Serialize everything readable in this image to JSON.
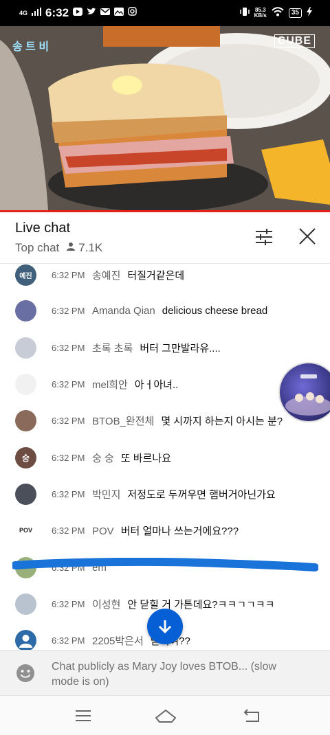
{
  "status_bar": {
    "network": "4G",
    "time": "6:32",
    "speed": "85.3",
    "speed_unit": "KB/s",
    "battery": "35"
  },
  "video": {
    "channel_logo": "CUBE",
    "show_logo": "송 트 비"
  },
  "chat_header": {
    "title": "Live chat",
    "mode": "Top chat",
    "viewer_count": "7.1K"
  },
  "messages": [
    {
      "avatar_text": "예진",
      "avatar_color": "#3f5f7a",
      "time": "6:32 PM",
      "author": "송예진",
      "text": "터질거같은데"
    },
    {
      "avatar_text": "",
      "avatar_color": "#6a6fa3",
      "time": "6:32 PM",
      "author": "Amanda Qian",
      "text": "delicious cheese bread"
    },
    {
      "avatar_text": "",
      "avatar_color": "#c8ccd6",
      "time": "6:32 PM",
      "author": "초록 초록",
      "text": "버터 그만발라유...."
    },
    {
      "avatar_text": "",
      "avatar_color": "#f4f4f4",
      "time": "6:32 PM",
      "author": "mel희안",
      "text": "아ㅓ아녀.."
    },
    {
      "avatar_text": "",
      "avatar_color": "#8a6a5a",
      "time": "6:32 PM",
      "author": "BTOB_완전체",
      "text": "몇 시까지 하는지 아시는 분?"
    },
    {
      "avatar_text": "숭",
      "avatar_color": "#6d4c41",
      "time": "6:32 PM",
      "author": "숭 숭",
      "text": "또 바르나요"
    },
    {
      "avatar_text": "",
      "avatar_color": "#4a4f5a",
      "time": "6:32 PM",
      "author": "박민지",
      "text": "저정도로 두꺼우면 햄버거아닌가요"
    },
    {
      "avatar_text": "POV",
      "avatar_color": "#ffffff",
      "time": "6:32 PM",
      "author": "POV",
      "text": "버터 얼마나 쓰는거에요???"
    },
    {
      "avatar_text": "",
      "avatar_color": "#9ab07a",
      "time": "6:32 PM",
      "author": "em",
      "text": ""
    },
    {
      "avatar_text": "",
      "avatar_color": "#b8c3cf",
      "time": "6:32 PM",
      "author": "이성현",
      "text": "안 닫힐 거 가튼데요?ㅋㅋㄱㄱㅋㅋ"
    },
    {
      "avatar_text": "",
      "avatar_color": "#2d6aa8",
      "time": "6:32 PM",
      "author": "2205박은서",
      "text": "닫혀여??"
    }
  ],
  "input": {
    "placeholder": "Chat publicly as Mary Joy loves BTOB... (slow mode is on)"
  },
  "icons": {
    "filter": "sliders-icon",
    "close": "close-icon",
    "scroll_down": "arrow-down-icon",
    "emoji": "emoji-icon",
    "nav_menu": "menu-icon",
    "nav_home": "home-icon",
    "nav_back": "back-icon"
  },
  "colors": {
    "accent_red": "#e62117",
    "scroll_button": "#065fd4",
    "scribble": "#1a73d9"
  }
}
